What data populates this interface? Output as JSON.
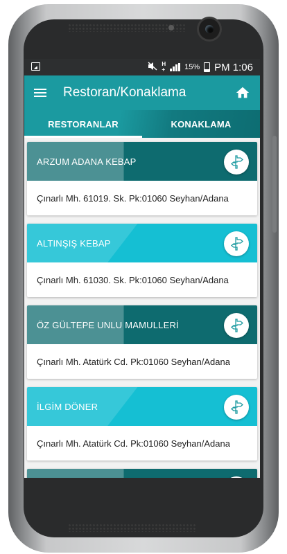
{
  "statusbar": {
    "battery": "15%",
    "time": "PM 1:06"
  },
  "appbar": {
    "title": "Restoran/Konaklama"
  },
  "tabs": [
    {
      "label": "RESTORANLAR",
      "active": true
    },
    {
      "label": "KONAKLAMA",
      "active": false
    }
  ],
  "restaurants": [
    {
      "name": "ARZUM ADANA KEBAP",
      "address": "Çınarlı Mh. 61019. Sk. Pk:01060 Seyhan/Adana",
      "header_color": "#0e6b6f"
    },
    {
      "name": "ALTINŞIŞ KEBAP",
      "address": "Çınarlı Mh. 61030. Sk. Pk:01060 Seyhan/Adana",
      "header_color": "#15bfd3"
    },
    {
      "name": "ÖZ GÜLTEPE UNLU MAMULLERİ",
      "address": "Çınarlı Mh. Atatürk Cd. Pk:01060 Seyhan/Adana",
      "header_color": "#0e6b6f"
    },
    {
      "name": "İLGİM DÖNER",
      "address": "Çınarlı Mh. Atatürk Cd. Pk:01060 Seyhan/Adana",
      "header_color": "#15bfd3"
    },
    {
      "name": "",
      "address": "",
      "header_color": "#0e6b6f"
    }
  ],
  "icons": {
    "menu": "hamburger-icon",
    "home": "home-icon",
    "directions": "signpost-icon"
  },
  "colors": {
    "primary": "#1b9aa0",
    "dark_teal": "#0e6b6f",
    "cyan": "#15bfd3"
  }
}
